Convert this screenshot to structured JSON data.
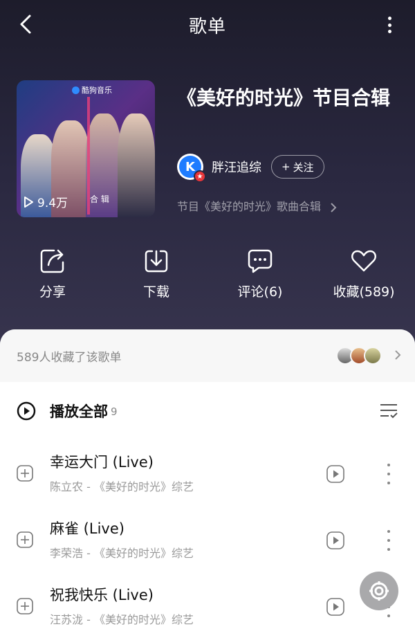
{
  "header": {
    "title": "歌单"
  },
  "cover": {
    "brand": "酷狗音乐",
    "play_count": "9.4万",
    "sub_text": "合  辑"
  },
  "playlist": {
    "title": "《美好的时光》节目合辑",
    "owner_name": "胖汪追综",
    "owner_avatar_letter": "K",
    "follow_label": "关注",
    "description": "节目《美好的时光》歌曲合辑"
  },
  "actions": [
    {
      "label": "分享",
      "icon": "share-icon"
    },
    {
      "label": "下载",
      "icon": "download-icon"
    },
    {
      "label": "评论(6)",
      "icon": "comment-icon"
    },
    {
      "label": "收藏(589)",
      "icon": "heart-icon"
    }
  ],
  "favorites": {
    "text": "589人收藏了该歌单"
  },
  "play_all": {
    "label": "播放全部",
    "count": "9"
  },
  "songs": [
    {
      "title": "幸运大门 (Live)",
      "subtitle": "陈立农 - 《美好的时光》综艺"
    },
    {
      "title": "麻雀 (Live)",
      "subtitle": "李荣浩 - 《美好的时光》综艺"
    },
    {
      "title": "祝我快乐 (Live)",
      "subtitle": "汪苏泷 - 《美好的时光》综艺"
    }
  ],
  "colors": {
    "hero_bg": "#2a2840",
    "accent_blue": "#1f7cff",
    "badge_red": "#e8363a"
  }
}
